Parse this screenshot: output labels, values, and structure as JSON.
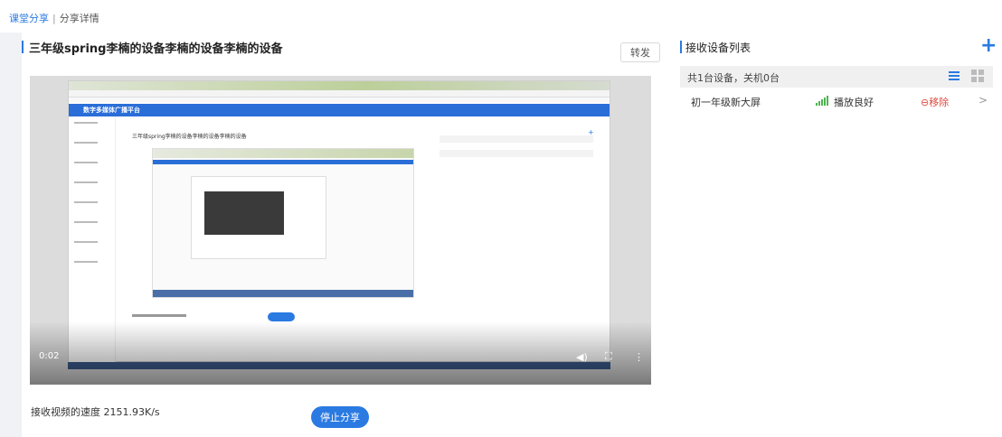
{
  "breadcrumb": {
    "parent": "课堂分享",
    "separator": "|",
    "current": "分享详情"
  },
  "main": {
    "title": "三年级spring李楠的设备李楠的设备李楠的设备",
    "forward_label": "转发",
    "video": {
      "time": "0:02",
      "inner_header": "数字多媒体广播平台"
    },
    "speed_label": "接收视频的速度",
    "speed_value": "2151.93K/s",
    "stop_label": "停止分享"
  },
  "sidebar": {
    "title": "接收设备列表",
    "summary": "共1台设备，关机0台",
    "devices": [
      {
        "name": "初一年级新大屏",
        "status": "播放良好",
        "signal_level": 5,
        "remove_label": "⊖移除"
      }
    ]
  },
  "colors": {
    "accent": "#2a7ae2",
    "remove": "#e0483c",
    "signal": "#4fb34f"
  },
  "icons": {
    "add": "plus-icon",
    "list_view": "list-view-icon",
    "grid_view": "grid-view-icon",
    "signal": "signal-icon",
    "chevron": "chevron-right-icon",
    "volume": "volume-icon",
    "fullscreen": "fullscreen-icon",
    "more": "more-icon"
  }
}
